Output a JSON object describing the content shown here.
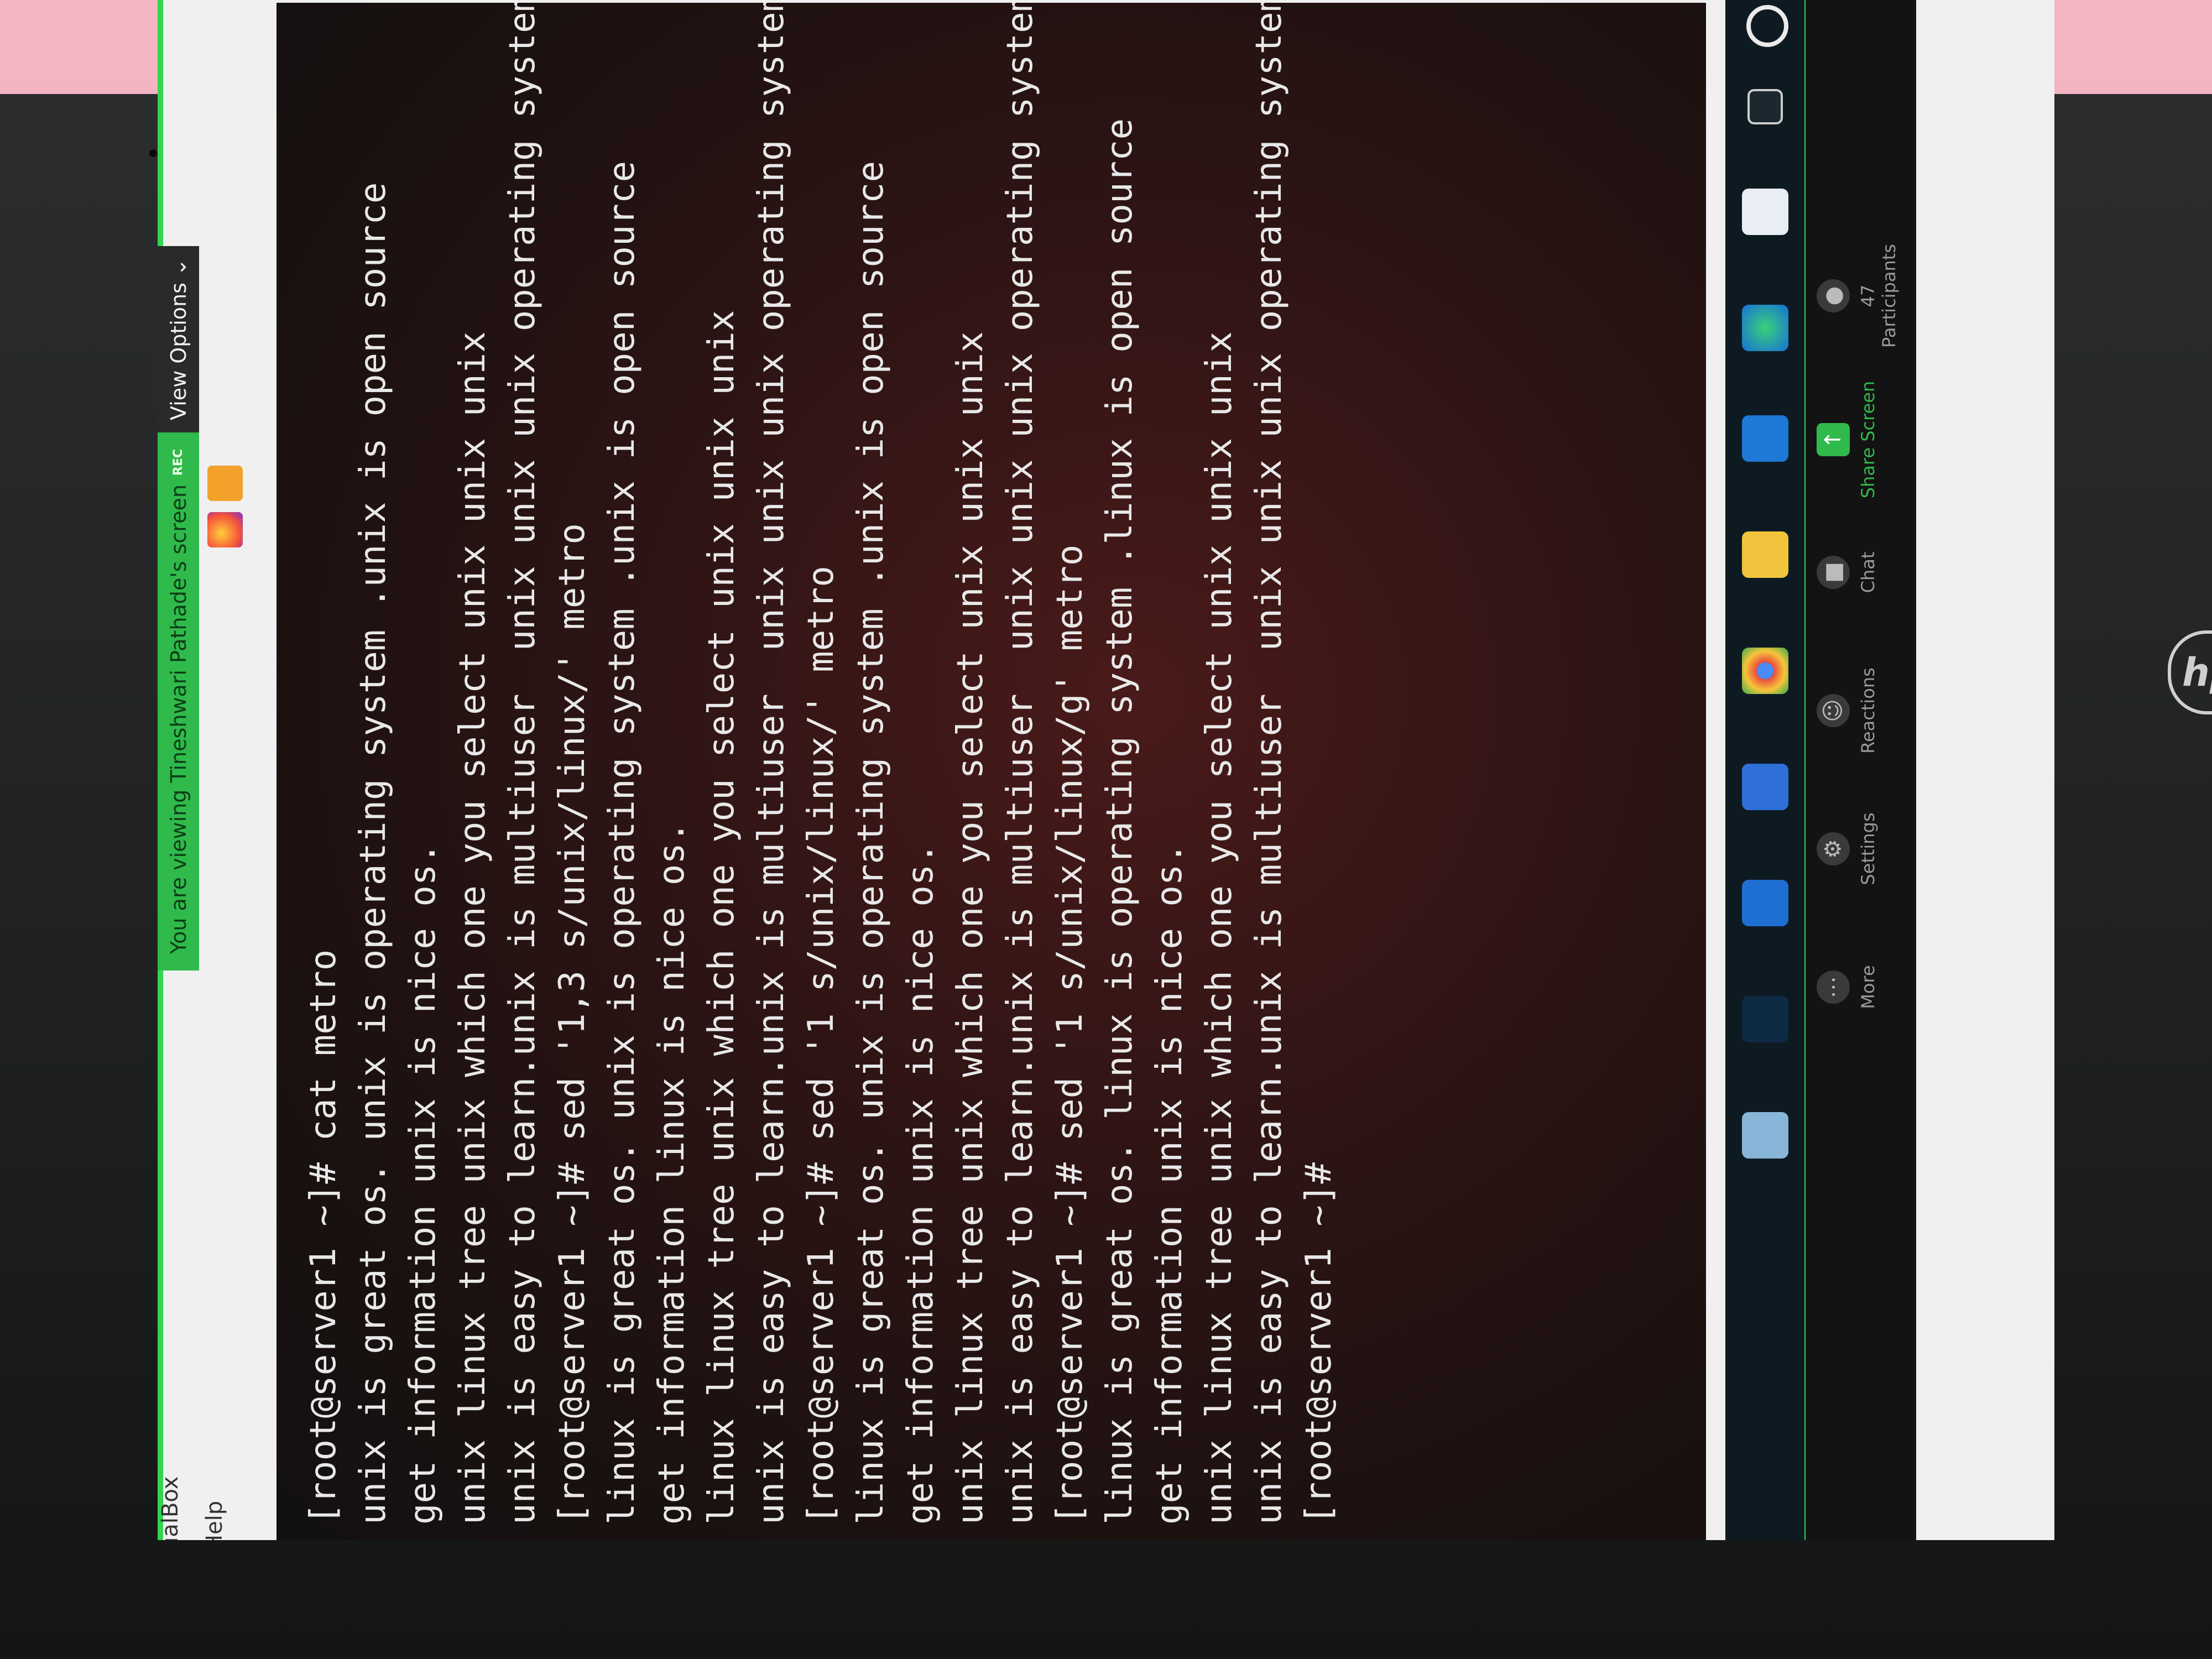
{
  "window": {
    "title": "ualBox",
    "menu_help": "Help"
  },
  "zoom_banner": {
    "viewing_text": "You are viewing Tineshwari Pathade's screen",
    "rec_label": "REC",
    "view_options_label": "View Options"
  },
  "terminal": {
    "lines": [
      "[root@server1 ~]# cat metro",
      "unix is great os. unix is operating system .unix is open source",
      "get information unix is nice os.",
      "unix linux tree unix which one you select unix unix unix",
      "unix is easy to learn.unix is multiuser  unix unix unix operating system",
      "[root@server1 ~]# sed '1,3 s/unix/linux/' metro",
      "linux is great os. unix is operating system .unix is open source",
      "get information linux is nice os.",
      "linux linux tree unix which one you select unix unix unix",
      "unix is easy to learn.unix is multiuser  unix unix unix operating system",
      "[root@server1 ~]# sed '1 s/unix/linux/' metro",
      "linux is great os. unix is operating system .unix is open source",
      "get information unix is nice os.",
      "unix linux tree unix which one you select unix unix unix",
      "unix is easy to learn.unix is multiuser  unix unix unix operating system",
      "[root@server1 ~]# sed '1 s/unix/linux/g' metro",
      "linux is great os. linux is operating system .linux is open source",
      "get information unix is nice os.",
      "unix linux tree unix which one you select unix unix unix",
      "unix is easy to learn.unix is multiuser  unix unix unix operating system",
      "[root@server1 ~]#"
    ]
  },
  "zoom_toolbar": {
    "participants_count": "47",
    "participants_label": "Participants",
    "share_label": "Share Screen",
    "chat_label": "Chat",
    "reactions_label": "Reactions",
    "settings_label": "Settings",
    "more_label": "More"
  },
  "laptop": {
    "brand": "hp"
  },
  "colors": {
    "zoom_green": "#2fba4b",
    "terminal_bg": "#1a1110",
    "terminal_fg": "#e8e8e8"
  }
}
